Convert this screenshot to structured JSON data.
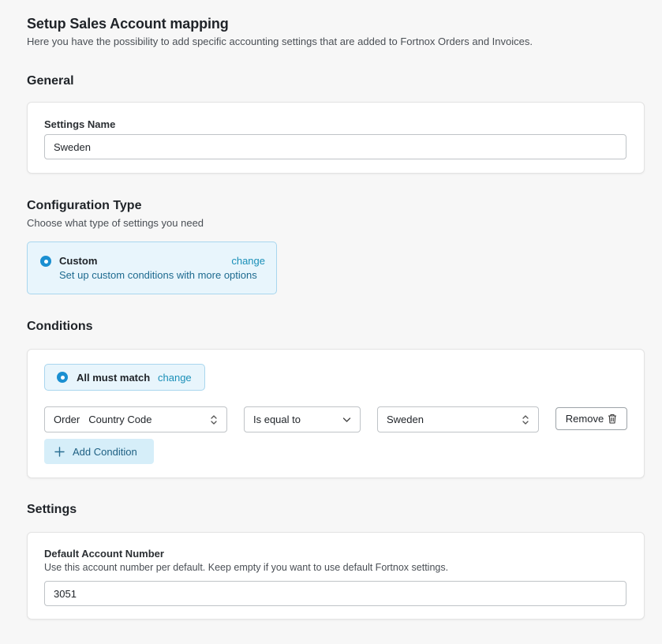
{
  "header": {
    "title": "Setup Sales Account mapping",
    "subtitle": "Here you have the possibility to add specific accounting settings that are added to Fortnox Orders and Invoices."
  },
  "general": {
    "section_title": "General",
    "settings_name_label": "Settings Name",
    "settings_name_value": "Sweden"
  },
  "configuration": {
    "section_title": "Configuration Type",
    "section_subtitle": "Choose what type of settings you need",
    "option_title": "Custom",
    "option_description": "Set up custom conditions with more options",
    "change_label": "change"
  },
  "conditions": {
    "section_title": "Conditions",
    "match_label": "All must match",
    "change_label": "change",
    "row": {
      "source_prefix": "Order",
      "source_field": "Country Code",
      "operator": "Is equal to",
      "value": "Sweden",
      "remove_label": "Remove"
    },
    "add_label": "Add Condition"
  },
  "settings": {
    "section_title": "Settings",
    "default_account_label": "Default Account Number",
    "default_account_help": "Use this account number per default. Keep empty if you want to use default Fortnox settings.",
    "default_account_value": "3051"
  },
  "colors": {
    "accent": "#1a8fd1",
    "link": "#1a8fb8",
    "info_bg": "#e8f5fc",
    "add_button_bg": "#d6eef9"
  },
  "icons": {
    "radio": "radio-selected-icon",
    "updown": "chevron-up-down-icon",
    "dropdown": "chevron-down-icon",
    "trash": "trash-icon",
    "plus": "plus-icon"
  }
}
